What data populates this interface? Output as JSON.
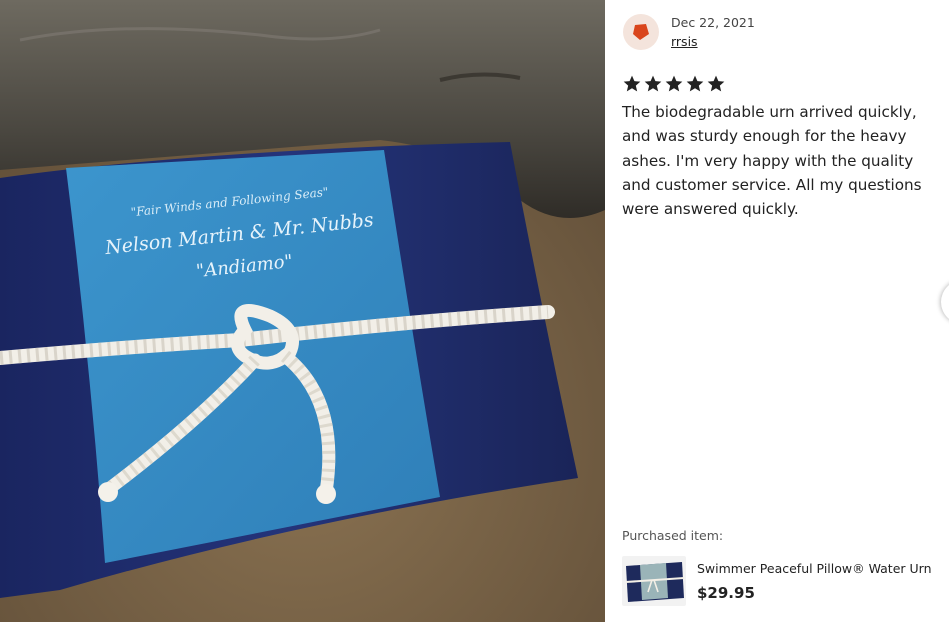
{
  "photo": {
    "label_motto": "\"Fair Winds and Following Seas\"",
    "label_names": "Nelson Martin & Mr. Nubbs",
    "label_nickname": "\"Andiamo\""
  },
  "review": {
    "avatar_icon": "reviewer-avatar-icon",
    "avatar_color": "#d9451c",
    "date": "Dec 22, 2021",
    "username": "rrsis",
    "rating": 5,
    "rating_max": 5,
    "text": "The biodegradable urn arrived quickly, and was sturdy enough for the heavy ashes. I'm very happy with the quality and customer service. All my questions were answered quickly."
  },
  "purchase": {
    "label": "Purchased item:",
    "item_name": "Swimmer Peaceful Pillow® Water Urn",
    "price": "$29.95"
  },
  "colors": {
    "star": "#222222",
    "urn_dark": "#1e2c66",
    "urn_band": "#3d8fc5"
  }
}
